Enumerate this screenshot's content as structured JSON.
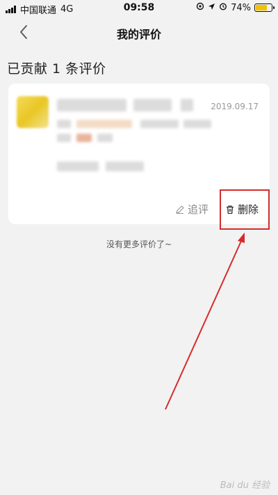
{
  "status_bar": {
    "carrier": "中国联通",
    "network": "4G",
    "time": "09:58",
    "battery_percent": "74%",
    "battery_level": 0.74,
    "battery_color": "#f2c200"
  },
  "nav": {
    "title": "我的评价",
    "back_icon": "chevron-left-icon"
  },
  "summary_text": "已贡献 1 条评价",
  "review": {
    "date": "2019.09.17",
    "actions": {
      "followup_label": "追评",
      "followup_icon": "pencil-icon",
      "delete_label": "删除",
      "delete_icon": "trash-icon"
    }
  },
  "footer_text": "没有更多评价了~",
  "annotation_color": "#d62b2b",
  "watermark_text": "Bai du 经验"
}
